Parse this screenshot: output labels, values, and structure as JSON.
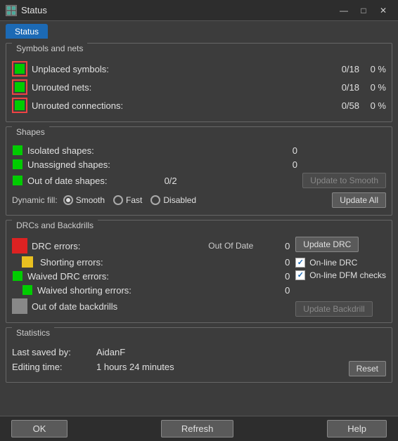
{
  "titlebar": {
    "icon_label": "S",
    "title": "Status",
    "minimize": "—",
    "maximize": "□",
    "close": "✕"
  },
  "tab": "Status",
  "sections": {
    "symbols_nets": {
      "title": "Symbols and nets",
      "rows": [
        {
          "label": "Unplaced symbols:",
          "value": "0/18",
          "pct": "0 %"
        },
        {
          "label": "Unrouted nets:",
          "value": "0/18",
          "pct": "0 %"
        },
        {
          "label": "Unrouted connections:",
          "value": "0/58",
          "pct": "0 %"
        }
      ]
    },
    "shapes": {
      "title": "Shapes",
      "rows": [
        {
          "label": "Isolated shapes:",
          "value": "0"
        },
        {
          "label": "Unassigned shapes:",
          "value": "0"
        },
        {
          "label": "Out of date shapes:",
          "value": "0/2"
        }
      ],
      "update_to_smooth_label": "Update to Smooth",
      "update_all_label": "Update All",
      "dynamic_fill_label": "Dynamic fill:",
      "radio_options": [
        "Smooth",
        "Fast",
        "Disabled"
      ],
      "selected_radio": "Smooth"
    },
    "drcs": {
      "title": "DRCs and Backdrills",
      "rows": [
        {
          "label": "DRC errors:",
          "sublabel": "Out Of Date",
          "value": "0",
          "led": "red"
        },
        {
          "label": "Shorting errors:",
          "value": "0",
          "led": "yellow"
        },
        {
          "label": "Waived DRC errors:",
          "value": "0",
          "led": "green"
        },
        {
          "label": "Waived shorting errors:",
          "value": "0",
          "led": "green_small"
        },
        {
          "label": "Out of date backdrills",
          "value": "",
          "led": "gray"
        }
      ],
      "update_drc_label": "Update DRC",
      "update_backdrill_label": "Update Backdrill",
      "online_drc_label": "On-line DRC",
      "online_dfm_label": "On-line DFM checks",
      "online_drc_checked": true,
      "online_dfm_checked": true
    },
    "statistics": {
      "title": "Statistics",
      "last_saved_label": "Last saved by:",
      "last_saved_value": "AidanF",
      "editing_time_label": "Editing time:",
      "editing_time_value": "1 hours 24 minutes",
      "reset_label": "Reset"
    }
  },
  "footer": {
    "ok_label": "OK",
    "refresh_label": "Refresh",
    "help_label": "Help"
  }
}
